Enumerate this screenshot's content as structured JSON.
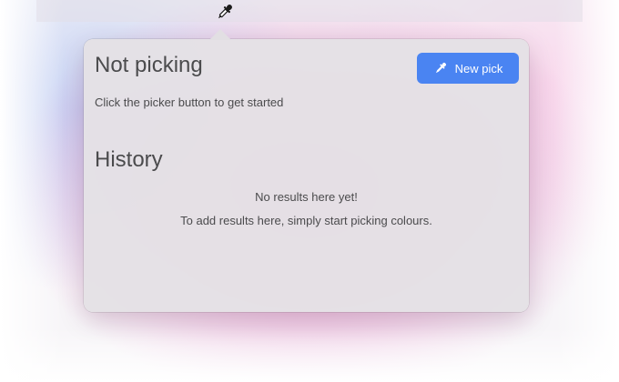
{
  "menubar": {
    "icon": "eyedropper-icon"
  },
  "status": {
    "title": "Not picking",
    "subtitle": "Click the picker button to get started"
  },
  "new_pick_button": {
    "label": "New pick",
    "icon": "eyedropper-icon"
  },
  "history": {
    "title": "History",
    "empty_primary": "No results here yet!",
    "empty_secondary": "To add results here, simply start picking colours."
  },
  "colors": {
    "accent": "#4a84f2",
    "text": "#4b4b4d",
    "popover_background": "#e4e1e5"
  }
}
